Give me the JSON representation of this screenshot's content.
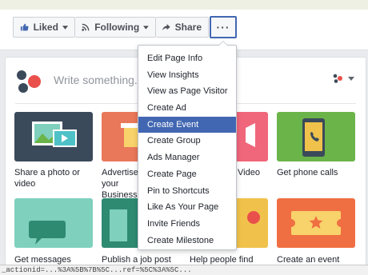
{
  "actions": {
    "liked": "Liked",
    "following": "Following",
    "share": "Share",
    "more": "···"
  },
  "composer": {
    "placeholder": "Write something..."
  },
  "tiles": [
    {
      "label": "Share a photo or video",
      "color": "#3b4a5a"
    },
    {
      "label": "Advertise your Business",
      "color": "#e9775a"
    },
    {
      "label": "Video",
      "color": "#f0667a"
    },
    {
      "label": "Get phone calls",
      "color": "#6bb44a"
    },
    {
      "label": "Get messages",
      "color": "#7fd0bd"
    },
    {
      "label": "Publish a job post",
      "color": "#2f8a72"
    },
    {
      "label": "Help people find",
      "color": "#f0c24b"
    },
    {
      "label": "Create an event",
      "color": "#ef6f42"
    }
  ],
  "menu": {
    "items": [
      "Edit Page Info",
      "View Insights",
      "View as Page Visitor",
      "Create Ad",
      "Create Event",
      "Create Group",
      "Ads Manager",
      "Create Page",
      "Pin to Shortcuts",
      "Like As Your Page",
      "Invite Friends",
      "Create Milestone"
    ],
    "highlighted": "Create Event"
  },
  "status_bar": "_actionid=...%3A%5B%7B%5C...ref=%5C%3A%5C..."
}
